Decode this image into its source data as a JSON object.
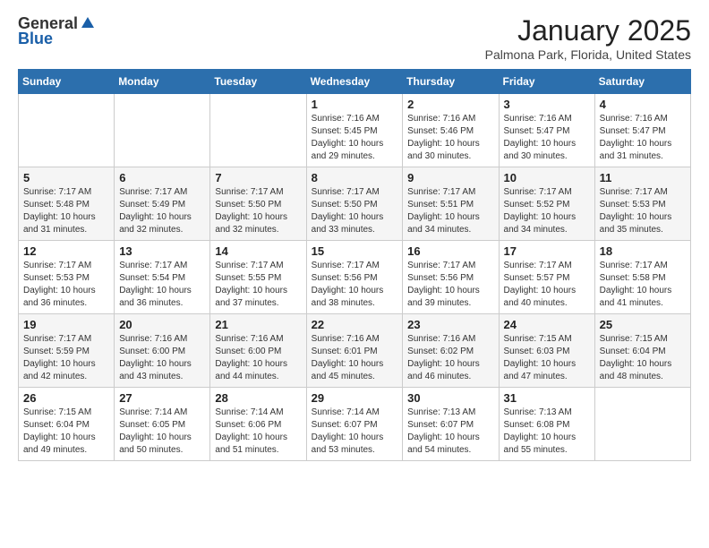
{
  "header": {
    "logo_general": "General",
    "logo_blue": "Blue",
    "title": "January 2025",
    "location": "Palmona Park, Florida, United States"
  },
  "weekdays": [
    "Sunday",
    "Monday",
    "Tuesday",
    "Wednesday",
    "Thursday",
    "Friday",
    "Saturday"
  ],
  "weeks": [
    [
      {
        "day": "",
        "info": ""
      },
      {
        "day": "",
        "info": ""
      },
      {
        "day": "",
        "info": ""
      },
      {
        "day": "1",
        "info": "Sunrise: 7:16 AM\nSunset: 5:45 PM\nDaylight: 10 hours\nand 29 minutes."
      },
      {
        "day": "2",
        "info": "Sunrise: 7:16 AM\nSunset: 5:46 PM\nDaylight: 10 hours\nand 30 minutes."
      },
      {
        "day": "3",
        "info": "Sunrise: 7:16 AM\nSunset: 5:47 PM\nDaylight: 10 hours\nand 30 minutes."
      },
      {
        "day": "4",
        "info": "Sunrise: 7:16 AM\nSunset: 5:47 PM\nDaylight: 10 hours\nand 31 minutes."
      }
    ],
    [
      {
        "day": "5",
        "info": "Sunrise: 7:17 AM\nSunset: 5:48 PM\nDaylight: 10 hours\nand 31 minutes."
      },
      {
        "day": "6",
        "info": "Sunrise: 7:17 AM\nSunset: 5:49 PM\nDaylight: 10 hours\nand 32 minutes."
      },
      {
        "day": "7",
        "info": "Sunrise: 7:17 AM\nSunset: 5:50 PM\nDaylight: 10 hours\nand 32 minutes."
      },
      {
        "day": "8",
        "info": "Sunrise: 7:17 AM\nSunset: 5:50 PM\nDaylight: 10 hours\nand 33 minutes."
      },
      {
        "day": "9",
        "info": "Sunrise: 7:17 AM\nSunset: 5:51 PM\nDaylight: 10 hours\nand 34 minutes."
      },
      {
        "day": "10",
        "info": "Sunrise: 7:17 AM\nSunset: 5:52 PM\nDaylight: 10 hours\nand 34 minutes."
      },
      {
        "day": "11",
        "info": "Sunrise: 7:17 AM\nSunset: 5:53 PM\nDaylight: 10 hours\nand 35 minutes."
      }
    ],
    [
      {
        "day": "12",
        "info": "Sunrise: 7:17 AM\nSunset: 5:53 PM\nDaylight: 10 hours\nand 36 minutes."
      },
      {
        "day": "13",
        "info": "Sunrise: 7:17 AM\nSunset: 5:54 PM\nDaylight: 10 hours\nand 36 minutes."
      },
      {
        "day": "14",
        "info": "Sunrise: 7:17 AM\nSunset: 5:55 PM\nDaylight: 10 hours\nand 37 minutes."
      },
      {
        "day": "15",
        "info": "Sunrise: 7:17 AM\nSunset: 5:56 PM\nDaylight: 10 hours\nand 38 minutes."
      },
      {
        "day": "16",
        "info": "Sunrise: 7:17 AM\nSunset: 5:56 PM\nDaylight: 10 hours\nand 39 minutes."
      },
      {
        "day": "17",
        "info": "Sunrise: 7:17 AM\nSunset: 5:57 PM\nDaylight: 10 hours\nand 40 minutes."
      },
      {
        "day": "18",
        "info": "Sunrise: 7:17 AM\nSunset: 5:58 PM\nDaylight: 10 hours\nand 41 minutes."
      }
    ],
    [
      {
        "day": "19",
        "info": "Sunrise: 7:17 AM\nSunset: 5:59 PM\nDaylight: 10 hours\nand 42 minutes."
      },
      {
        "day": "20",
        "info": "Sunrise: 7:16 AM\nSunset: 6:00 PM\nDaylight: 10 hours\nand 43 minutes."
      },
      {
        "day": "21",
        "info": "Sunrise: 7:16 AM\nSunset: 6:00 PM\nDaylight: 10 hours\nand 44 minutes."
      },
      {
        "day": "22",
        "info": "Sunrise: 7:16 AM\nSunset: 6:01 PM\nDaylight: 10 hours\nand 45 minutes."
      },
      {
        "day": "23",
        "info": "Sunrise: 7:16 AM\nSunset: 6:02 PM\nDaylight: 10 hours\nand 46 minutes."
      },
      {
        "day": "24",
        "info": "Sunrise: 7:15 AM\nSunset: 6:03 PM\nDaylight: 10 hours\nand 47 minutes."
      },
      {
        "day": "25",
        "info": "Sunrise: 7:15 AM\nSunset: 6:04 PM\nDaylight: 10 hours\nand 48 minutes."
      }
    ],
    [
      {
        "day": "26",
        "info": "Sunrise: 7:15 AM\nSunset: 6:04 PM\nDaylight: 10 hours\nand 49 minutes."
      },
      {
        "day": "27",
        "info": "Sunrise: 7:14 AM\nSunset: 6:05 PM\nDaylight: 10 hours\nand 50 minutes."
      },
      {
        "day": "28",
        "info": "Sunrise: 7:14 AM\nSunset: 6:06 PM\nDaylight: 10 hours\nand 51 minutes."
      },
      {
        "day": "29",
        "info": "Sunrise: 7:14 AM\nSunset: 6:07 PM\nDaylight: 10 hours\nand 53 minutes."
      },
      {
        "day": "30",
        "info": "Sunrise: 7:13 AM\nSunset: 6:07 PM\nDaylight: 10 hours\nand 54 minutes."
      },
      {
        "day": "31",
        "info": "Sunrise: 7:13 AM\nSunset: 6:08 PM\nDaylight: 10 hours\nand 55 minutes."
      },
      {
        "day": "",
        "info": ""
      }
    ]
  ]
}
